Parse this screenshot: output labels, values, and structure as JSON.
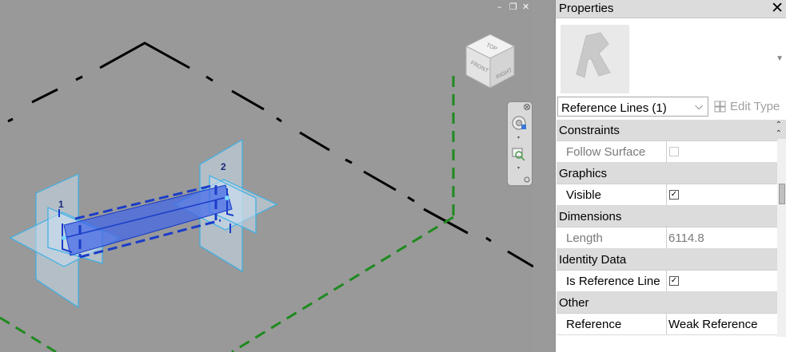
{
  "window_controls": {
    "minimize": "–",
    "restore": "❐",
    "close": "✕"
  },
  "viewcube": {
    "top": "TOP",
    "front": "FRONT",
    "right": "RIGHT"
  },
  "viewport": {
    "ref_label_1": "1",
    "ref_label_2": "2",
    "colors": {
      "background": "#999999",
      "reference_plane": "#000000",
      "green_dashed": "#1f8a1f",
      "selection": "#2255dd",
      "work_plane": "#5bc0f0"
    }
  },
  "properties": {
    "title": "Properties",
    "close_icon": "close-x",
    "type_selector": {
      "value": "Reference Lines (1)"
    },
    "edit_type": "Edit Type",
    "groups": [
      {
        "label": "Constraints",
        "rows": [
          {
            "name": "Follow Surface",
            "value": "",
            "checkbox": false,
            "enabled": false
          }
        ]
      },
      {
        "label": "Graphics",
        "rows": [
          {
            "name": "Visible",
            "value": "",
            "checkbox": true,
            "enabled": true
          }
        ]
      },
      {
        "label": "Dimensions",
        "rows": [
          {
            "name": "Length",
            "value": "6114.8",
            "enabled": false
          }
        ]
      },
      {
        "label": "Identity Data",
        "rows": [
          {
            "name": "Is Reference Line",
            "value": "",
            "checkbox": true,
            "enabled": true
          }
        ]
      },
      {
        "label": "Other",
        "rows": [
          {
            "name": "Reference",
            "value": "Weak Reference",
            "enabled": true
          }
        ]
      }
    ]
  }
}
